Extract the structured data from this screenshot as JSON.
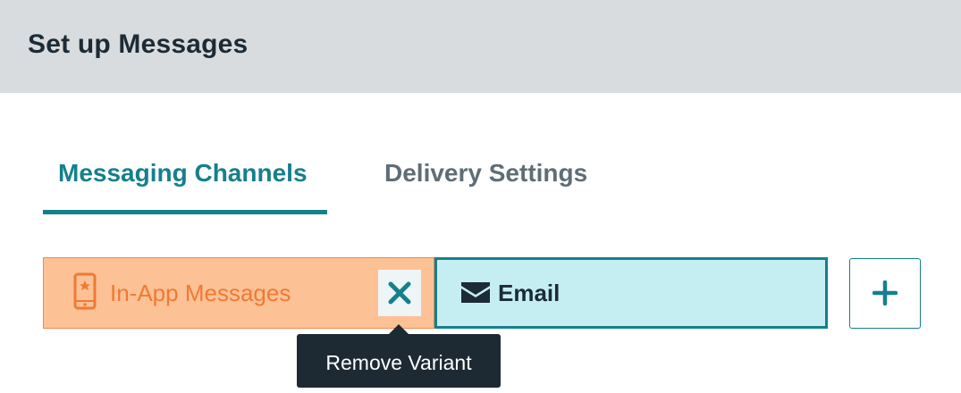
{
  "header": {
    "title": "Set up Messages"
  },
  "tabs": [
    {
      "label": "Messaging Channels",
      "active": true
    },
    {
      "label": "Delivery Settings",
      "active": false
    }
  ],
  "variants": [
    {
      "label": "In-App Messages",
      "icon": "mobile-phone-star-icon",
      "color": "#fdc196",
      "accent": "#ef7a33"
    },
    {
      "label": "Email",
      "icon": "envelope-icon",
      "color": "#c5eef3",
      "accent": "#15808c",
      "selected": true
    }
  ],
  "remove_button": {
    "icon": "close-icon"
  },
  "add_button": {
    "icon": "plus-icon"
  },
  "tooltip": {
    "text": "Remove Variant"
  },
  "colors": {
    "brand": "#15808c",
    "header_bg": "#d9dcdf",
    "tooltip_bg": "#1e2a33"
  }
}
